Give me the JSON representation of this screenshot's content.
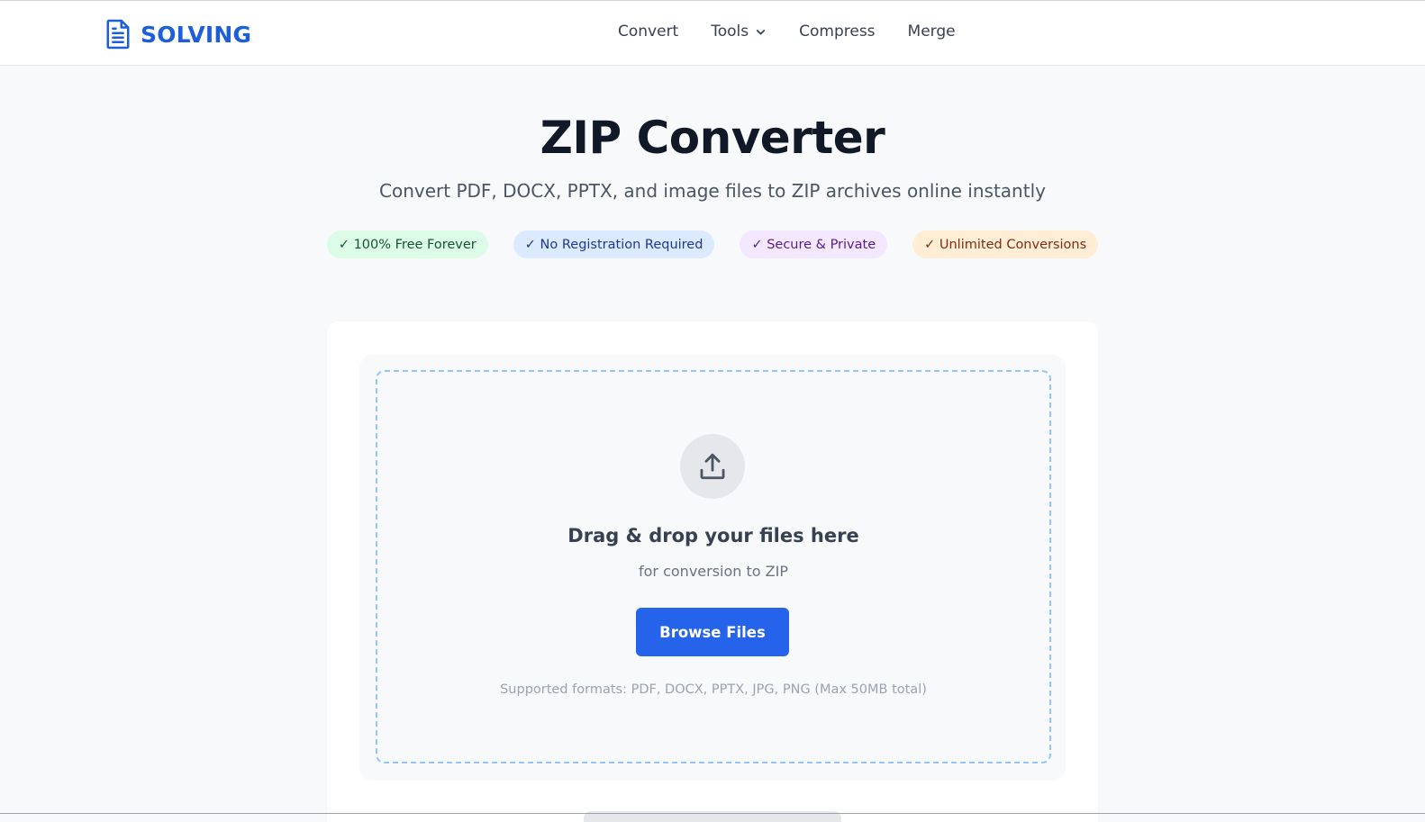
{
  "brand": {
    "name": "SOLVING",
    "icon": "document-icon",
    "color": "#1d5fd8"
  },
  "nav": {
    "items": [
      {
        "label": "Convert"
      },
      {
        "label": "Tools",
        "has_dropdown": true
      },
      {
        "label": "Compress"
      },
      {
        "label": "Merge"
      }
    ]
  },
  "hero": {
    "title": "ZIP Converter",
    "subtitle": "Convert PDF, DOCX, PPTX, and image files to ZIP archives online instantly"
  },
  "badges": [
    {
      "label": "✓ 100% Free Forever",
      "color": "green"
    },
    {
      "label": "✓ No Registration Required",
      "color": "blue"
    },
    {
      "label": "✓ Secure & Private",
      "color": "purple"
    },
    {
      "label": "✓ Unlimited Conversions",
      "color": "orange"
    }
  ],
  "upload": {
    "icon": "upload-icon",
    "title": "Drag & drop your files here",
    "subtitle": "for conversion to ZIP",
    "button_label": "Browse Files",
    "formats_note": "Supported formats: PDF, DOCX, PPTX, JPG, PNG (Max 50MB total)"
  },
  "colors": {
    "accent": "#2563eb",
    "dropzone_border": "#93c5fd",
    "page_bg": "#f8f9fb"
  }
}
